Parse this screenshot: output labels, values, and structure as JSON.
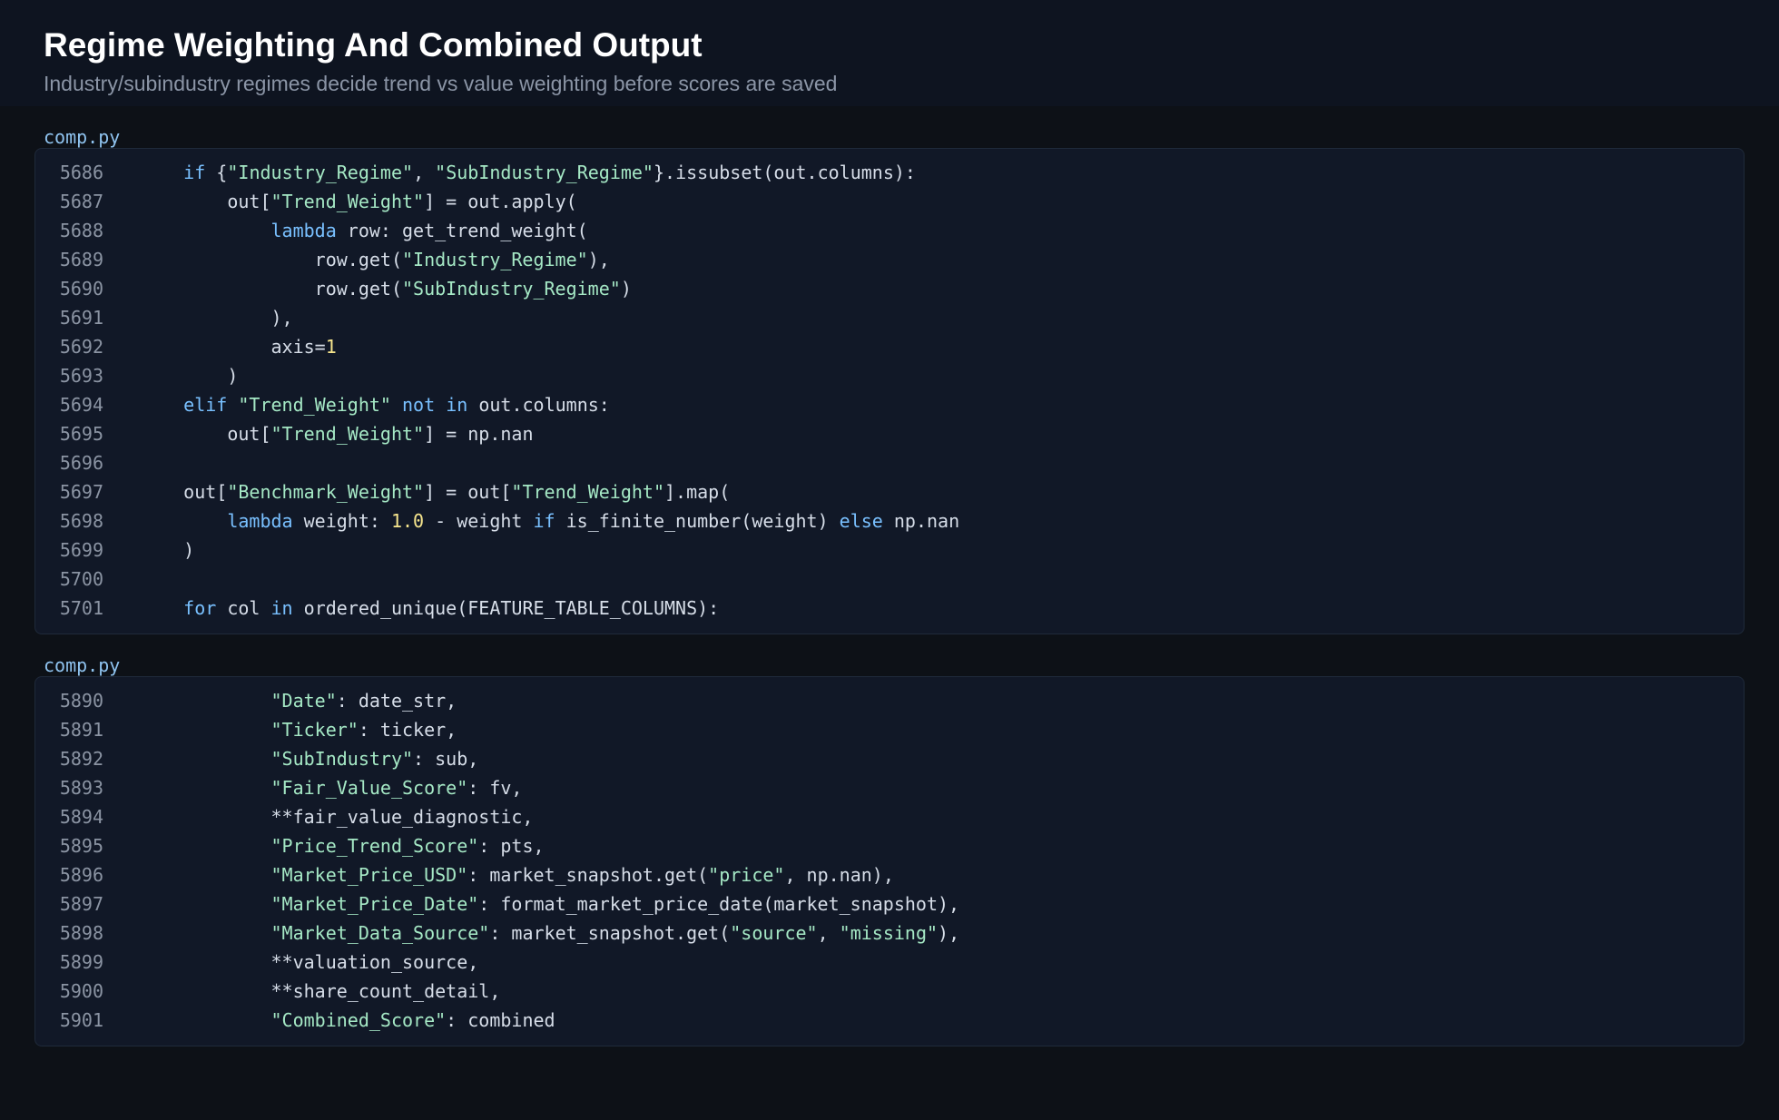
{
  "header": {
    "title": "Regime Weighting And Combined Output",
    "subtitle": "Industry/subindustry regimes decide trend vs value weighting before scores are saved"
  },
  "colors": {
    "background": "#0d1117",
    "panel": "#111827",
    "keyword": "#79c0ff",
    "string": "#a5e8c5",
    "number": "#f6e58d",
    "text": "#d6dde8",
    "line_number": "#8b94a3",
    "file_label": "#8fc3ef"
  },
  "code_blocks": [
    {
      "file": "comp.py",
      "lines": [
        {
          "no": "5686",
          "tokens": [
            {
              "t": "    ",
              "k": "plain"
            },
            {
              "t": "if",
              "k": "kw"
            },
            {
              "t": " {",
              "k": "plain"
            },
            {
              "t": "\"Industry_Regime\"",
              "k": "str"
            },
            {
              "t": ", ",
              "k": "plain"
            },
            {
              "t": "\"SubIndustry_Regime\"",
              "k": "str"
            },
            {
              "t": "}.issubset(out.columns):",
              "k": "plain"
            }
          ]
        },
        {
          "no": "5687",
          "tokens": [
            {
              "t": "        out[",
              "k": "plain"
            },
            {
              "t": "\"Trend_Weight\"",
              "k": "str"
            },
            {
              "t": "] = out.apply(",
              "k": "plain"
            }
          ]
        },
        {
          "no": "5688",
          "tokens": [
            {
              "t": "            ",
              "k": "plain"
            },
            {
              "t": "lambda",
              "k": "kw"
            },
            {
              "t": " row: get_trend_weight(",
              "k": "plain"
            }
          ]
        },
        {
          "no": "5689",
          "tokens": [
            {
              "t": "                row.get(",
              "k": "plain"
            },
            {
              "t": "\"Industry_Regime\"",
              "k": "str"
            },
            {
              "t": "),",
              "k": "plain"
            }
          ]
        },
        {
          "no": "5690",
          "tokens": [
            {
              "t": "                row.get(",
              "k": "plain"
            },
            {
              "t": "\"SubIndustry_Regime\"",
              "k": "str"
            },
            {
              "t": ")",
              "k": "plain"
            }
          ]
        },
        {
          "no": "5691",
          "tokens": [
            {
              "t": "            ),",
              "k": "plain"
            }
          ]
        },
        {
          "no": "5692",
          "tokens": [
            {
              "t": "            axis=",
              "k": "plain"
            },
            {
              "t": "1",
              "k": "num"
            }
          ]
        },
        {
          "no": "5693",
          "tokens": [
            {
              "t": "        )",
              "k": "plain"
            }
          ]
        },
        {
          "no": "5694",
          "tokens": [
            {
              "t": "    ",
              "k": "plain"
            },
            {
              "t": "elif",
              "k": "kw"
            },
            {
              "t": " ",
              "k": "plain"
            },
            {
              "t": "\"Trend_Weight\"",
              "k": "str"
            },
            {
              "t": " ",
              "k": "plain"
            },
            {
              "t": "not",
              "k": "kw"
            },
            {
              "t": " ",
              "k": "plain"
            },
            {
              "t": "in",
              "k": "kw"
            },
            {
              "t": " out.columns:",
              "k": "plain"
            }
          ]
        },
        {
          "no": "5695",
          "tokens": [
            {
              "t": "        out[",
              "k": "plain"
            },
            {
              "t": "\"Trend_Weight\"",
              "k": "str"
            },
            {
              "t": "] = np.nan",
              "k": "plain"
            }
          ]
        },
        {
          "no": "5696",
          "tokens": []
        },
        {
          "no": "5697",
          "tokens": [
            {
              "t": "    out[",
              "k": "plain"
            },
            {
              "t": "\"Benchmark_Weight\"",
              "k": "str"
            },
            {
              "t": "] = out[",
              "k": "plain"
            },
            {
              "t": "\"Trend_Weight\"",
              "k": "str"
            },
            {
              "t": "].map(",
              "k": "plain"
            }
          ]
        },
        {
          "no": "5698",
          "tokens": [
            {
              "t": "        ",
              "k": "plain"
            },
            {
              "t": "lambda",
              "k": "kw"
            },
            {
              "t": " weight: ",
              "k": "plain"
            },
            {
              "t": "1.0",
              "k": "num"
            },
            {
              "t": " - weight ",
              "k": "plain"
            },
            {
              "t": "if",
              "k": "kw"
            },
            {
              "t": " is_finite_number(weight) ",
              "k": "plain"
            },
            {
              "t": "else",
              "k": "kw"
            },
            {
              "t": " np.nan",
              "k": "plain"
            }
          ]
        },
        {
          "no": "5699",
          "tokens": [
            {
              "t": "    )",
              "k": "plain"
            }
          ]
        },
        {
          "no": "5700",
          "tokens": []
        },
        {
          "no": "5701",
          "tokens": [
            {
              "t": "    ",
              "k": "plain"
            },
            {
              "t": "for",
              "k": "kw"
            },
            {
              "t": " col ",
              "k": "plain"
            },
            {
              "t": "in",
              "k": "kw"
            },
            {
              "t": " ordered_unique(FEATURE_TABLE_COLUMNS):",
              "k": "plain"
            }
          ]
        }
      ]
    },
    {
      "file": "comp.py",
      "lines": [
        {
          "no": "5890",
          "tokens": [
            {
              "t": "            ",
              "k": "plain"
            },
            {
              "t": "\"Date\"",
              "k": "str"
            },
            {
              "t": ": date_str,",
              "k": "plain"
            }
          ]
        },
        {
          "no": "5891",
          "tokens": [
            {
              "t": "            ",
              "k": "plain"
            },
            {
              "t": "\"Ticker\"",
              "k": "str"
            },
            {
              "t": ": ticker,",
              "k": "plain"
            }
          ]
        },
        {
          "no": "5892",
          "tokens": [
            {
              "t": "            ",
              "k": "plain"
            },
            {
              "t": "\"SubIndustry\"",
              "k": "str"
            },
            {
              "t": ": sub,",
              "k": "plain"
            }
          ]
        },
        {
          "no": "5893",
          "tokens": [
            {
              "t": "            ",
              "k": "plain"
            },
            {
              "t": "\"Fair_Value_Score\"",
              "k": "str"
            },
            {
              "t": ": fv,",
              "k": "plain"
            }
          ]
        },
        {
          "no": "5894",
          "tokens": [
            {
              "t": "            **fair_value_diagnostic,",
              "k": "plain"
            }
          ]
        },
        {
          "no": "5895",
          "tokens": [
            {
              "t": "            ",
              "k": "plain"
            },
            {
              "t": "\"Price_Trend_Score\"",
              "k": "str"
            },
            {
              "t": ": pts,",
              "k": "plain"
            }
          ]
        },
        {
          "no": "5896",
          "tokens": [
            {
              "t": "            ",
              "k": "plain"
            },
            {
              "t": "\"Market_Price_USD\"",
              "k": "str"
            },
            {
              "t": ": market_snapshot.get(",
              "k": "plain"
            },
            {
              "t": "\"price\"",
              "k": "str"
            },
            {
              "t": ", np.nan),",
              "k": "plain"
            }
          ]
        },
        {
          "no": "5897",
          "tokens": [
            {
              "t": "            ",
              "k": "plain"
            },
            {
              "t": "\"Market_Price_Date\"",
              "k": "str"
            },
            {
              "t": ": format_market_price_date(market_snapshot),",
              "k": "plain"
            }
          ]
        },
        {
          "no": "5898",
          "tokens": [
            {
              "t": "            ",
              "k": "plain"
            },
            {
              "t": "\"Market_Data_Source\"",
              "k": "str"
            },
            {
              "t": ": market_snapshot.get(",
              "k": "plain"
            },
            {
              "t": "\"source\"",
              "k": "str"
            },
            {
              "t": ", ",
              "k": "plain"
            },
            {
              "t": "\"missing\"",
              "k": "str"
            },
            {
              "t": "),",
              "k": "plain"
            }
          ]
        },
        {
          "no": "5899",
          "tokens": [
            {
              "t": "            **valuation_source,",
              "k": "plain"
            }
          ]
        },
        {
          "no": "5900",
          "tokens": [
            {
              "t": "            **share_count_detail,",
              "k": "plain"
            }
          ]
        },
        {
          "no": "5901",
          "tokens": [
            {
              "t": "            ",
              "k": "plain"
            },
            {
              "t": "\"Combined_Score\"",
              "k": "str"
            },
            {
              "t": ": combined",
              "k": "plain"
            }
          ]
        }
      ]
    }
  ]
}
